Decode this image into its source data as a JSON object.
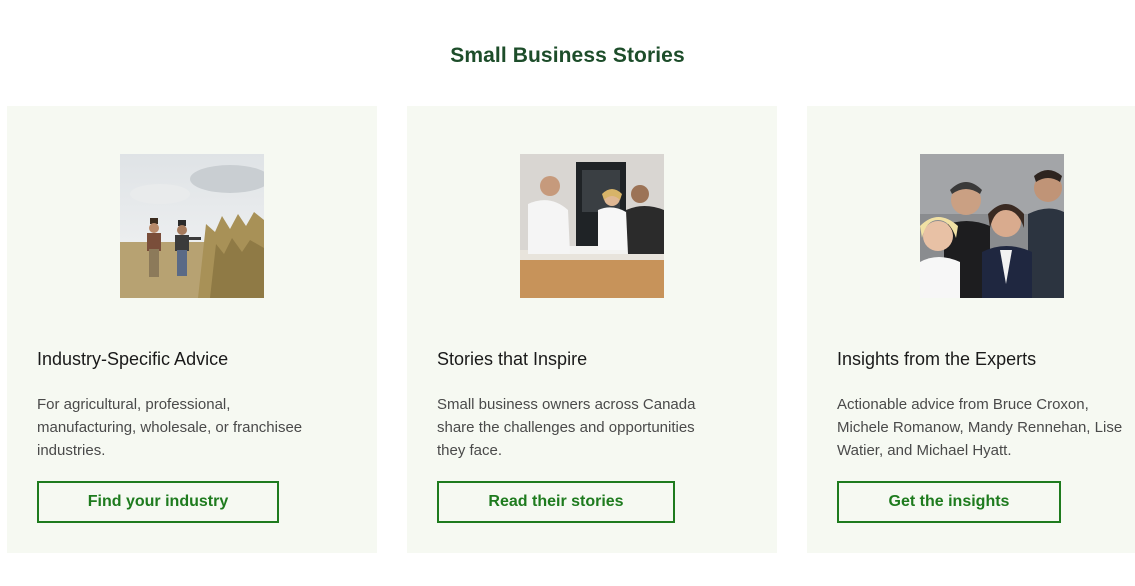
{
  "section": {
    "title": "Small Business Stories"
  },
  "cards": [
    {
      "heading": "Industry-Specific Advice",
      "text": "For agricultural, professional, manufacturing, wholesale, or franchisee industries.",
      "button": "Find your industry",
      "image": "farmers-in-field-photo"
    },
    {
      "heading": "Stories that Inspire",
      "text": "Small business owners across Canada share the challenges and opportunities they face.",
      "button": "Read their stories",
      "image": "team-reviewing-plans-photo"
    },
    {
      "heading": "Insights from the Experts",
      "text": "Actionable advice from Bruce Croxon, Michele Romanow, Mandy Rennehan, Lise Watier, and Michael Hyatt.",
      "button": "Get the insights",
      "image": "experts-group-portrait-photo"
    }
  ],
  "colors": {
    "title": "#1d4d2a",
    "card_background": "#f6f9f2",
    "button_accent": "#1e7b1e"
  }
}
